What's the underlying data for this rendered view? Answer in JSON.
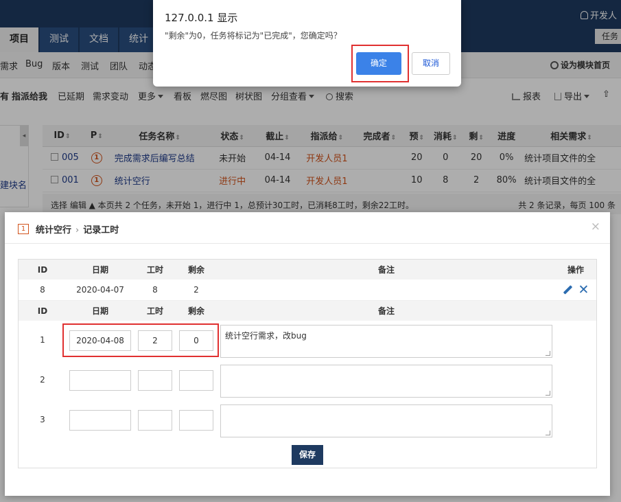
{
  "header": {
    "user": "开发人",
    "tabs": [
      "项目",
      "测试",
      "文档",
      "统计"
    ],
    "task_chip": "任务"
  },
  "subnav": {
    "items": [
      "需求",
      "Bug",
      "版本",
      "测试",
      "团队",
      "动态"
    ],
    "module_home": "设为模块首页"
  },
  "toolbar": {
    "items": [
      "有",
      "指派给我",
      "已延期",
      "需求变动",
      "更多",
      "看板",
      "燃尽图",
      "树状图",
      "分组查看",
      "搜索"
    ],
    "report": "报表",
    "export": "导出"
  },
  "left_panel": {
    "label": "建块名"
  },
  "task_table": {
    "headers": [
      "ID",
      "P",
      "任务名称",
      "状态",
      "截止",
      "指派给",
      "完成者",
      "预",
      "消耗",
      "剩",
      "进度",
      "相关需求"
    ],
    "rows": [
      {
        "id": "005",
        "pri": "1",
        "name": "完成需求后编写总结",
        "status": "未开始",
        "deadline": "04-14",
        "assigned": "开发人员1",
        "finished_by": "",
        "estimate": "20",
        "consumed": "0",
        "left": "20",
        "progress": "0%",
        "story": "统计项目文件的全"
      },
      {
        "id": "001",
        "pri": "1",
        "name": "统计空行",
        "status": "进行中",
        "deadline": "04-14",
        "assigned": "开发人员1",
        "finished_by": "",
        "estimate": "10",
        "consumed": "8",
        "left": "2",
        "progress": "80%",
        "story": "统计项目文件的全"
      }
    ],
    "footer_left": "选择    编辑  ▲  本页共 2 个任务，未开始 1，进行中 1，总预计30工时，已消耗8工时，剩余22工时。",
    "footer_right": "共 2 条记录，每页 100 条"
  },
  "modal": {
    "task_number": "1",
    "task_name": "统计空行",
    "action": "记录工时",
    "close": "×",
    "headers": {
      "id": "ID",
      "date": "日期",
      "hours": "工时",
      "left": "剩余",
      "note": "备注",
      "op": "操作"
    },
    "history": [
      {
        "id": "8",
        "date": "2020-04-07",
        "hours": "8",
        "left": "2"
      }
    ],
    "entries": [
      {
        "num": "1",
        "date": "2020-04-08",
        "hours": "2",
        "left": "0",
        "note": "统计空行需求，改bug"
      },
      {
        "num": "2",
        "date": "",
        "hours": "",
        "left": "",
        "note": ""
      },
      {
        "num": "3",
        "date": "",
        "hours": "",
        "left": "",
        "note": ""
      }
    ],
    "save": "保存"
  },
  "alert": {
    "title": "127.0.0.1 显示",
    "message": "\"剩余\"为0，任务将标记为\"已完成\"，您确定吗？",
    "ok": "确定",
    "cancel": "取消"
  },
  "colors": {
    "nav": "#1e3a60",
    "accent": "#3b82e8",
    "highlight": "#e03030",
    "orange": "#d2531b"
  }
}
